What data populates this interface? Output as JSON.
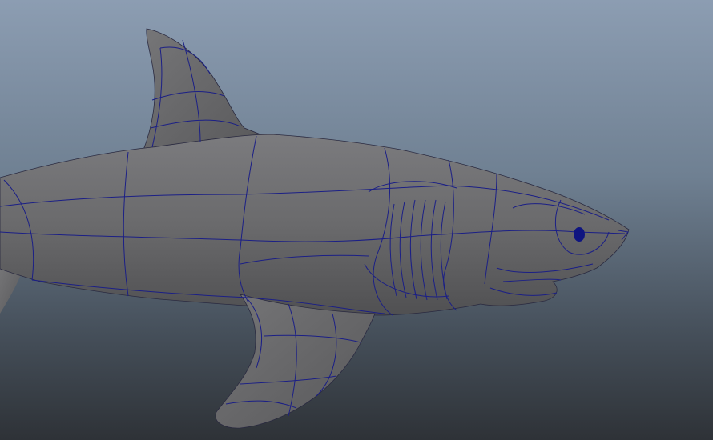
{
  "viewport": {
    "model": "shark",
    "display_mode": "smooth-shade-wireframe-on-shaded",
    "colors": {
      "background_top": "#8c9db2",
      "background_bottom": "#2e3237",
      "mesh_surface": "#6d6d6f",
      "wireframe": "#1b1f86",
      "eye": "#0f1580"
    }
  }
}
